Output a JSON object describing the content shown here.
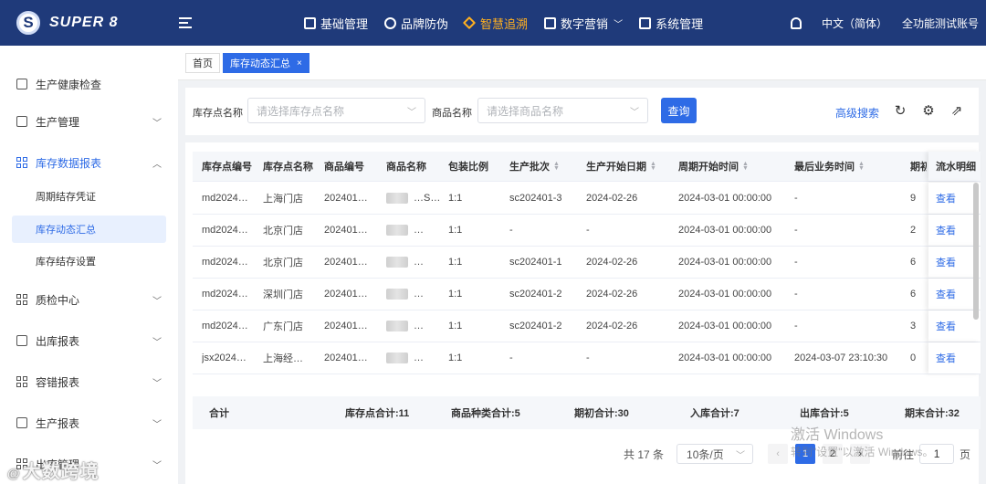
{
  "app": {
    "logo_letter": "S",
    "logo_text": "SUPER 8"
  },
  "nav": {
    "items": [
      {
        "label": "基础管理",
        "icon": "square-icon"
      },
      {
        "label": "品牌防伪",
        "icon": "search-icon"
      },
      {
        "label": "智慧追溯",
        "icon": "diamond-icon",
        "active": true
      },
      {
        "label": "数字营销",
        "icon": "box-icon",
        "has_chevron": true
      },
      {
        "label": "系统管理",
        "icon": "monitor-icon"
      }
    ],
    "language": "中文（简体）",
    "account": "全功能测试账号"
  },
  "sidebar": {
    "items": [
      {
        "label": "生产健康检查"
      },
      {
        "label": "生产管理"
      },
      {
        "label": "库存数据报表",
        "open": true
      },
      {
        "label": "周期结存凭证",
        "sub": true
      },
      {
        "label": "库存动态汇总",
        "sub": true,
        "active": true
      },
      {
        "label": "库存结存设置",
        "sub": true
      },
      {
        "label": "质检中心"
      },
      {
        "label": "出库报表"
      },
      {
        "label": "容错报表"
      },
      {
        "label": "生产报表"
      },
      {
        "label": "出库管理"
      }
    ]
  },
  "tabs": [
    {
      "label": "首页"
    },
    {
      "label": "库存动态汇总",
      "active": true,
      "close": "×"
    }
  ],
  "search": {
    "warehouse_label": "库存点名称",
    "warehouse_placeholder": "请选择库存点名称",
    "product_label": "商品名称",
    "product_placeholder": "请选择商品名称",
    "query_button": "查询",
    "advanced": "高级搜索"
  },
  "table": {
    "columns": [
      "库存点编号",
      "库存点名称",
      "商品编号",
      "商品名称",
      "包装比例",
      "生产批次",
      "生产开始日期",
      "周期开始时间",
      "最后业务时间",
      "期初"
    ],
    "fixed_column": "流水明细",
    "rows": [
      {
        "code": "md2024…",
        "name": "上海门店",
        "pcode": "202401…",
        "pname": "…S…",
        "ratio": "1:1",
        "batch": "sc202401-3",
        "start_date": "2024-02-26",
        "period_start": "2024-03-01 00:00:00",
        "last_time": "-",
        "opening": "9",
        "action": "查看"
      },
      {
        "code": "md2024…",
        "name": "北京门店",
        "pcode": "202401…",
        "pname": "…",
        "ratio": "1:1",
        "batch": "-",
        "start_date": "-",
        "period_start": "2024-03-01 00:00:00",
        "last_time": "-",
        "opening": "2",
        "action": "查看"
      },
      {
        "code": "md2024…",
        "name": "北京门店",
        "pcode": "202401…",
        "pname": "…",
        "ratio": "1:1",
        "batch": "sc202401-1",
        "start_date": "2024-02-26",
        "period_start": "2024-03-01 00:00:00",
        "last_time": "-",
        "opening": "6",
        "action": "查看"
      },
      {
        "code": "md2024…",
        "name": "深圳门店",
        "pcode": "202401…",
        "pname": "…",
        "ratio": "1:1",
        "batch": "sc202401-2",
        "start_date": "2024-02-26",
        "period_start": "2024-03-01 00:00:00",
        "last_time": "-",
        "opening": "6",
        "action": "查看"
      },
      {
        "code": "md2024…",
        "name": "广东门店",
        "pcode": "202401…",
        "pname": "…",
        "ratio": "1:1",
        "batch": "sc202401-2",
        "start_date": "2024-02-26",
        "period_start": "2024-03-01 00:00:00",
        "last_time": "-",
        "opening": "3",
        "action": "查看"
      },
      {
        "code": "jsx2024…",
        "name": "上海经…",
        "pcode": "202401…",
        "pname": "…",
        "ratio": "1:1",
        "batch": "-",
        "start_date": "-",
        "period_start": "2024-03-01 00:00:00",
        "last_time": "2024-03-07 23:10:30",
        "opening": "0",
        "action": "查看"
      }
    ],
    "footer": {
      "label": "合计",
      "warehouse_total": "库存点合计:11",
      "product_kinds": "商品种类合计:5",
      "opening_total": "期初合计:30",
      "inbound_total": "入库合计:7",
      "outbound_total": "出库合计:5",
      "closing_total": "期末合计:32"
    }
  },
  "pagination": {
    "total": "共 17 条",
    "page_size": "10条/页",
    "prev": "‹",
    "pages": [
      "1",
      "2"
    ],
    "next": "›",
    "goto_label": "前往",
    "goto_value": "1",
    "page_unit": "页"
  },
  "overlay": {
    "windows_title": "激活 Windows",
    "windows_sub": "转到\"设置\"以激活 Windows。",
    "stamp": "大数跨境"
  }
}
